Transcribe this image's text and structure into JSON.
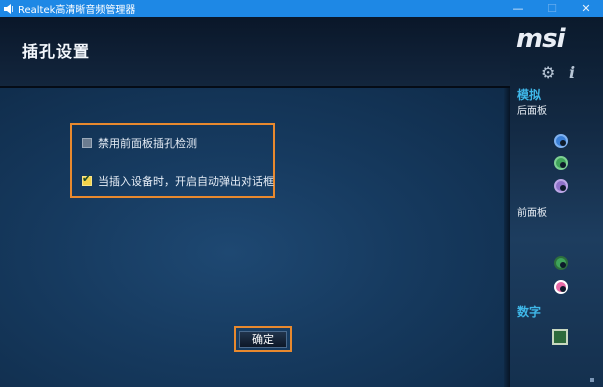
{
  "window": {
    "title": "Realtek高清晰音频管理器",
    "minimize_symbol": "—",
    "maximize_symbol": "☐",
    "close_symbol": "✕"
  },
  "page": {
    "title": "插孔设置"
  },
  "options": [
    {
      "label": "禁用前面板插孔检测",
      "checked": false
    },
    {
      "label": "当插入设备时，开启自动弹出对话框",
      "checked": true
    }
  ],
  "buttons": {
    "ok": "确定"
  },
  "sidebar": {
    "brand": "msi",
    "settings_icon": "gear-icon",
    "info_icon": "info-icon",
    "analog_label": "模拟",
    "back_panel_label": "后面板",
    "front_panel_label": "前面板",
    "digital_label": "数字",
    "jack_colors": {
      "back_blue": "#3a7fd6",
      "back_green": "#3fa45a",
      "back_purple": "#8f72c9",
      "front_green": "#3fa45a",
      "front_pink": "#e86aa6"
    }
  },
  "colors": {
    "titlebar": "#1e88e5",
    "highlight_border": "#e8892e",
    "section_accent": "#3fb7e8"
  }
}
